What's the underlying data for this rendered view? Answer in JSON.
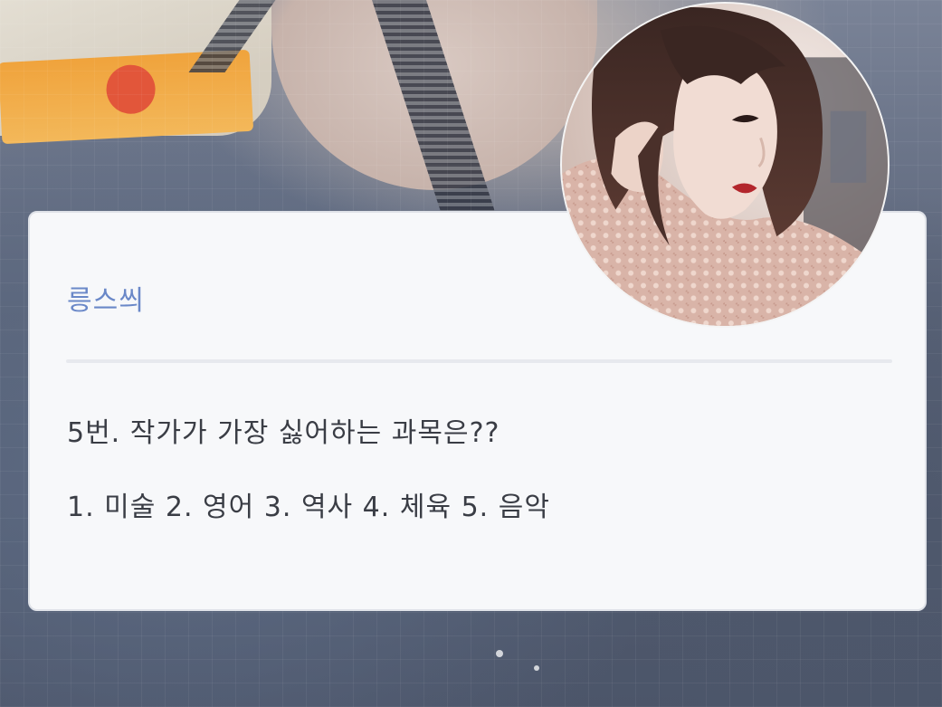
{
  "card": {
    "name": "릉스씌",
    "question": "5번. 작가가 가장 싫어하는 과목은??",
    "options": "1. 미술 2. 영어 3. 역사 4. 체육 5. 음악"
  },
  "colors": {
    "name": "#6a88c8",
    "text": "#3a3d45",
    "card_bg": "#f7f8fa"
  },
  "avatar": {
    "icon": "profile-photo"
  }
}
